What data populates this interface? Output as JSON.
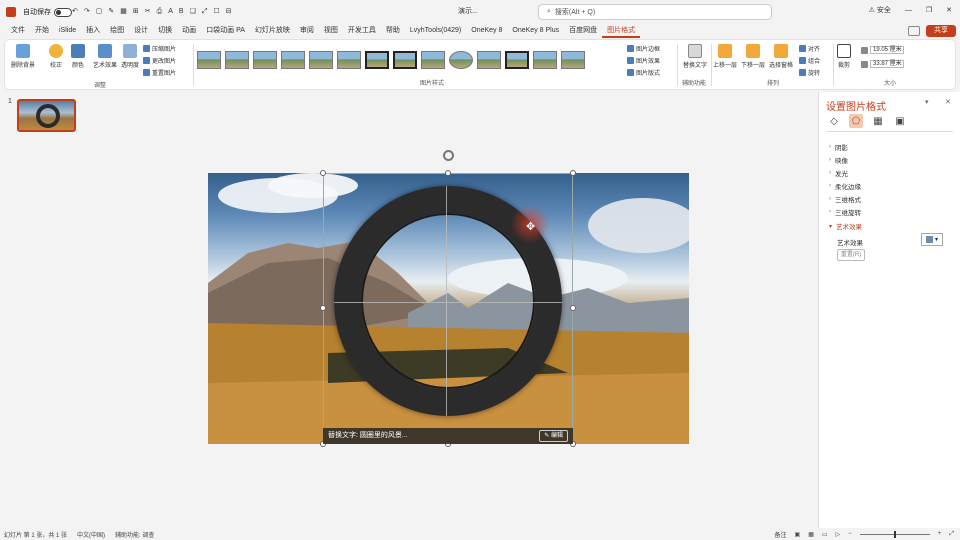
{
  "titlebar": {
    "autosave_label": "自动保存",
    "autosave_state": "关",
    "file_name": "演示...",
    "search_placeholder": "搜索(Alt + Q)",
    "warning_label": "⚠ 安全",
    "share_label": "共享",
    "window_controls": [
      "—",
      "❐",
      "✕"
    ],
    "qat": [
      "↶",
      "↷",
      "▢",
      "✎",
      "▦",
      "⊞",
      "✂",
      "⎙",
      "A",
      "B",
      "❏",
      "⤢",
      "☐",
      "⊟"
    ]
  },
  "tabs": [
    "文件",
    "开始",
    "iSlide",
    "插入",
    "绘图",
    "设计",
    "切换",
    "动画",
    "口袋动画 PA",
    "幻灯片放映",
    "审阅",
    "视图",
    "开发工具",
    "帮助",
    "LvyhTools(0429)",
    "OneKey 8",
    "OneKey 8 Plus",
    "百度网盘",
    "图片格式"
  ],
  "active_tab": "图片格式",
  "ribbon": {
    "adjust": {
      "label": "调整",
      "buttons": [
        "删除背景",
        "校正",
        "颜色",
        "艺术效果",
        "透明度"
      ],
      "small": [
        "压缩图片",
        "更改图片",
        "重置图片"
      ]
    },
    "styles": {
      "label": "图片样式",
      "side": [
        "图片边框",
        "图片效果",
        "图片版式"
      ]
    },
    "accessibility": {
      "label": "辅助功能",
      "button": "替换文字"
    },
    "arrange": {
      "label": "排列",
      "buttons": [
        "上移一层",
        "下移一层",
        "选择窗格"
      ],
      "small": [
        "对齐",
        "组合",
        "旋转"
      ]
    },
    "size": {
      "label": "大小",
      "crop": "裁剪",
      "height": "19.05 厘米",
      "width": "33.87 厘米"
    }
  },
  "slide_panel": {
    "number": "1"
  },
  "slide": {
    "alt_text": "替换文字: 圆圈里的风景...",
    "edit_label": "✎ 编辑"
  },
  "format_pane": {
    "title": "设置图片格式",
    "sections": [
      "阴影",
      "映像",
      "发光",
      "柔化边缘",
      "三维格式",
      "三维旋转",
      "艺术效果"
    ],
    "effect_label": "艺术效果",
    "reset_label": "重置(R)"
  },
  "status": {
    "slide_info": "幻灯片 第 1 张，共 1 张",
    "lang": "中文(中国)",
    "accessibility": "辅助功能: 调查",
    "notes": "备注",
    "zoom": "+"
  },
  "colors": {
    "accent": "#c43e1c"
  }
}
